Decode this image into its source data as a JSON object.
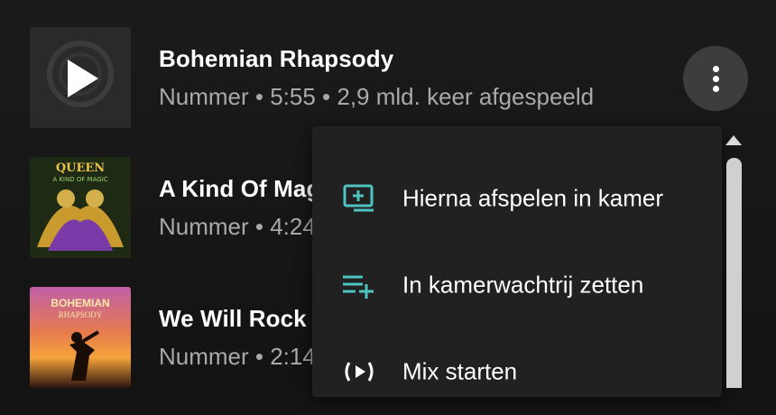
{
  "songs": [
    {
      "title": "Bohemian Rhapsody",
      "meta": "Nummer • 5:55 • 2,9 mld. keer afgespeeld"
    },
    {
      "title": "A Kind Of Magic",
      "meta": "Nummer • 4:24"
    },
    {
      "title": "We Will Rock You",
      "meta": "Nummer • 2:14"
    }
  ],
  "thumbnails": {
    "album_art_2_text": "QUEEN",
    "album_art_2_subtext": "A KIND OF MAGIC",
    "album_art_3_text": "BOHEMIAN",
    "album_art_3_subtext": "RHAPSODY"
  },
  "menu": {
    "items": [
      {
        "label": "Hierna afspelen in kamer",
        "icon": "play-next-icon"
      },
      {
        "label": "In kamerwachtrij zetten",
        "icon": "add-to-queue-icon"
      },
      {
        "label": "Mix starten",
        "icon": "radio-mix-icon"
      }
    ]
  },
  "colors": {
    "accent": "#4fc3c0",
    "background": "#141414",
    "menu_background": "#212121",
    "secondary_text": "#a9a9a9"
  }
}
